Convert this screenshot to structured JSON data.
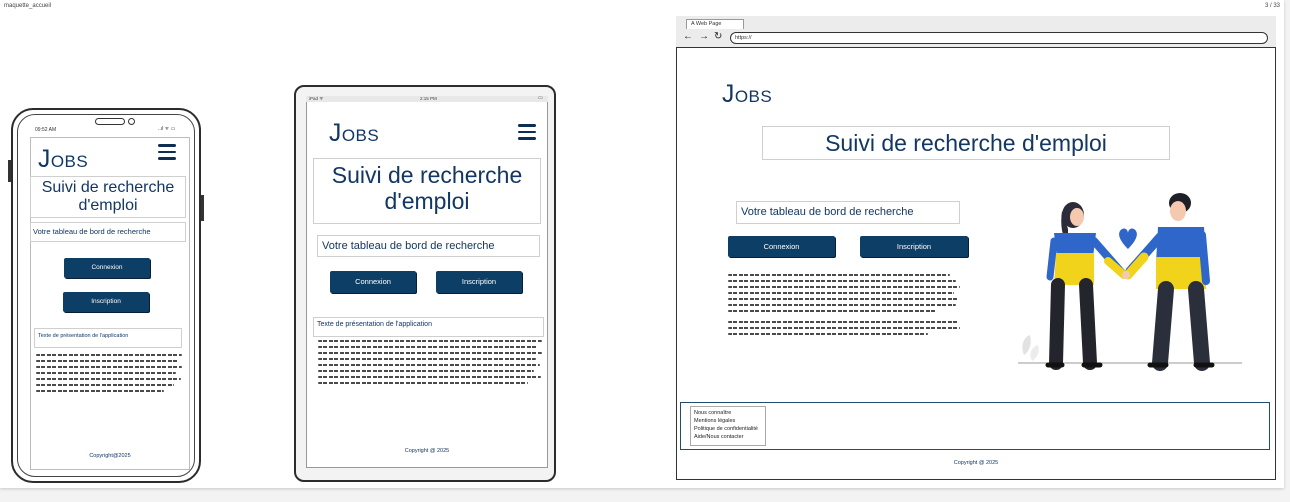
{
  "window": {
    "file_name": "maquette_accueil",
    "page_counter": "3 / 33"
  },
  "common": {
    "logo_J": "J",
    "logo_rest": "OBS",
    "title": "Suivi de recherche d'emploi",
    "title_line1": "Suivi de recherche",
    "title_line2": "d'emploi",
    "dashboard": "Votre tableau de bord de recherche",
    "login_button": "Connexion",
    "register_button": "Inscription",
    "presentation": "Texte de présentation de l'application"
  },
  "phone": {
    "time": "09:52 AM",
    "status_icons": "..ıl ᯤ ▭",
    "copyright": "Copyright@2025"
  },
  "tablet": {
    "status_left": "iPad ᯤ",
    "time": "2:15 PM",
    "battery": "▭",
    "copyright": "Copyright @ 2025"
  },
  "browser": {
    "tab_title": "A Web Page",
    "url": "https://",
    "footer_links": [
      "Nous connaître",
      "Mentions légales",
      "Politique de confidentialité",
      "Aide/Nous contacter"
    ],
    "copyright": "Copyright @ 2025",
    "illustration": "couple-holding-hands-illustration",
    "colors": {
      "yellow": "#f2d31b",
      "blue": "#2e66c9",
      "navy": "#0d3e66"
    }
  }
}
